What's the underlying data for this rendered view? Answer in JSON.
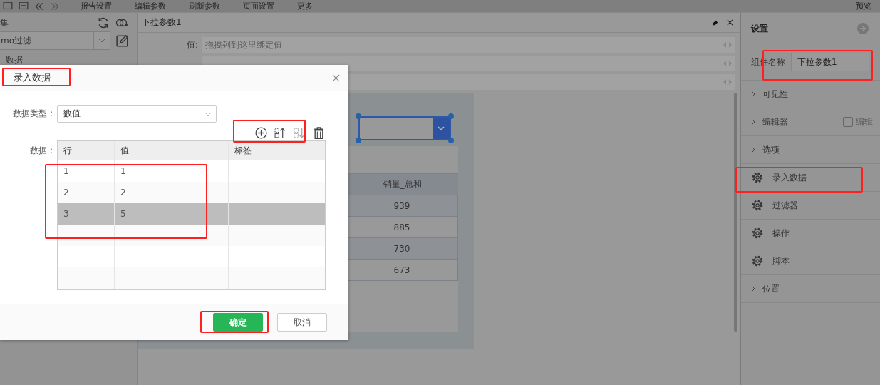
{
  "toolbar": {
    "menus": [
      "报告设置",
      "编辑参数",
      "刷新参数",
      "页面设置",
      "更多"
    ],
    "right_action": "预览"
  },
  "left_panel": {
    "title": "集",
    "dataset": "mo过滤",
    "tab": "数据"
  },
  "editor": {
    "title": "下拉参数1",
    "bindings": [
      {
        "label": "值:",
        "placeholder": "拖拽列到这里绑定值"
      }
    ]
  },
  "canvas": {
    "column_header": "销量_总和",
    "values": [
      "939",
      "885",
      "730",
      "673"
    ]
  },
  "settings": {
    "title": "设置",
    "name_label": "组件名称",
    "name_value": "下拉参数1",
    "sections": [
      {
        "kind": "expander",
        "label": "可见性"
      },
      {
        "kind": "expander",
        "label": "编辑器",
        "option": {
          "label": "编辑",
          "checked": false,
          "disabled": true
        }
      },
      {
        "kind": "expander",
        "label": "选项"
      },
      {
        "kind": "action",
        "label": "录入数据"
      },
      {
        "kind": "action",
        "label": "过滤器"
      },
      {
        "kind": "action",
        "label": "操作"
      },
      {
        "kind": "action",
        "label": "脚本"
      },
      {
        "kind": "expander",
        "label": "位置"
      }
    ]
  },
  "dialog": {
    "title": "录入数据",
    "type_label": "数据类型 :",
    "type_value": "数值",
    "data_label": "数据 :",
    "columns": [
      "行",
      "值",
      "标签"
    ],
    "rows": [
      {
        "cells": [
          "1",
          "1"
        ],
        "selected": false
      },
      {
        "cells": [
          "2",
          "2"
        ],
        "selected": false
      },
      {
        "cells": [
          "3",
          "5"
        ],
        "selected": true
      }
    ],
    "buttons": [
      {
        "label": "确定",
        "kind": "primary"
      },
      {
        "label": "取消",
        "kind": "default"
      }
    ]
  }
}
